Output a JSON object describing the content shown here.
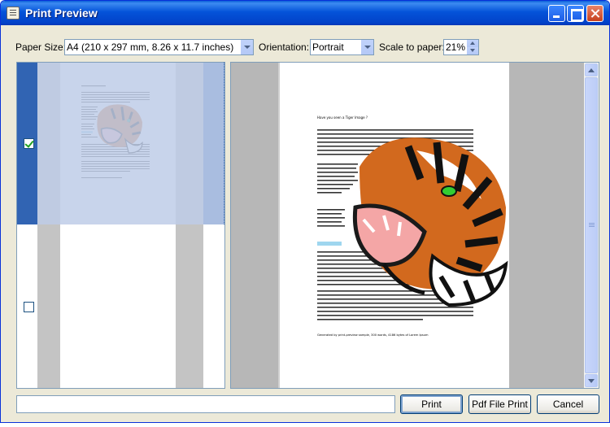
{
  "window": {
    "title": "Print Preview"
  },
  "toolbar": {
    "paper_size_label": "Paper Size:",
    "paper_size_value": "A4 (210 x 297 mm, 8.26 x 11.7 inches)",
    "orientation_label": "Orientation:",
    "orientation_value": "Portrait",
    "scale_label": "Scale to paper:",
    "scale_value": "21%"
  },
  "thumbnails": [
    {
      "checked": true
    },
    {
      "checked": false
    }
  ],
  "preview": {
    "heading": "Have you seen a Tiger Image ?",
    "footer": "Generated by print-preview sample, 300 words, 4186 bytes of Lorem Ipsum"
  },
  "buttons": {
    "print": "Print",
    "pdf": "Pdf File Print",
    "cancel": "Cancel"
  },
  "colors": {
    "selection": "#3164b3",
    "titlebar": "#0453d9",
    "accent_highlight": "#9fd6ef"
  }
}
